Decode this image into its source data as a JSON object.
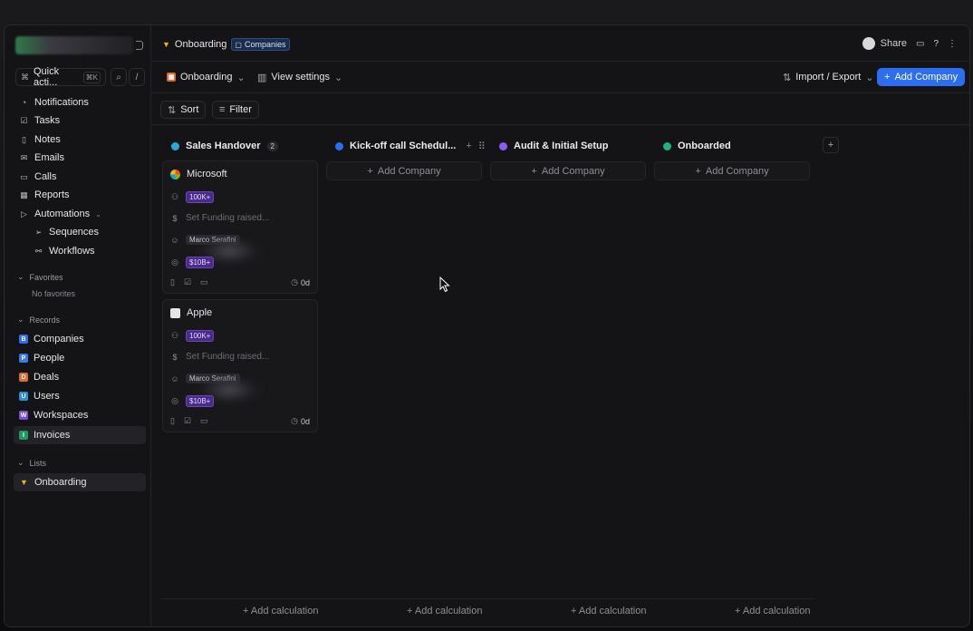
{
  "sidebar": {
    "quick_actions": "Quick acti...",
    "quick_kbd": "⌘K",
    "slash": "/",
    "nav": [
      {
        "label": "Notifications",
        "icon": "bell-icon"
      },
      {
        "label": "Tasks",
        "icon": "checkbox-icon"
      },
      {
        "label": "Notes",
        "icon": "note-icon"
      },
      {
        "label": "Emails",
        "icon": "mail-icon"
      },
      {
        "label": "Calls",
        "icon": "video-icon"
      },
      {
        "label": "Reports",
        "icon": "chart-icon"
      },
      {
        "label": "Automations",
        "icon": "play-icon"
      }
    ],
    "sub_nav": [
      {
        "label": "Sequences",
        "icon": "send-icon"
      },
      {
        "label": "Workflows",
        "icon": "workflow-icon"
      }
    ],
    "favorites_title": "Favorites",
    "no_favorites": "No favorites",
    "records_title": "Records",
    "records": [
      {
        "label": "Companies",
        "color": "#2b6ef0",
        "letter": "B"
      },
      {
        "label": "People",
        "color": "#3a7bea",
        "letter": "P"
      },
      {
        "label": "Deals",
        "color": "#e06a2b",
        "letter": "D"
      },
      {
        "label": "Users",
        "color": "#2f8fd6",
        "letter": "U"
      },
      {
        "label": "Workspaces",
        "color": "#7a4fe0",
        "letter": "W"
      },
      {
        "label": "Invoices",
        "color": "#1f9a63",
        "letter": "I"
      }
    ],
    "lists_title": "Lists",
    "lists": [
      {
        "label": "Onboarding"
      }
    ]
  },
  "header": {
    "title": "Onboarding",
    "tag": "Companies",
    "share": "Share"
  },
  "toolbar": {
    "view": "Onboarding",
    "view_settings": "View settings",
    "import_export": "Import / Export",
    "add_company": "Add Company"
  },
  "filterbar": {
    "sort": "Sort",
    "filter": "Filter"
  },
  "columns": [
    {
      "name": "Sales Handover",
      "color": "#2aa8d8",
      "count": "2"
    },
    {
      "name": "Kick-off call Schedul...",
      "color": "#2b6ef0"
    },
    {
      "name": "Audit & Initial Setup",
      "color": "#8a5cf0"
    },
    {
      "name": "Onboarded",
      "color": "#1fb27a"
    }
  ],
  "add_company_label": "Add Company",
  "cards": [
    {
      "name": "Microsoft",
      "size": "100K+",
      "funding": "Set Funding raised...",
      "owner": "Marco Serafini",
      "value": "$10B+",
      "age": "0d"
    },
    {
      "name": "Apple",
      "size": "100K+",
      "funding": "Set Funding raised...",
      "owner": "Marco Serafini",
      "value": "$10B+",
      "age": "0d"
    }
  ],
  "add_calculation": "+ Add calculation"
}
